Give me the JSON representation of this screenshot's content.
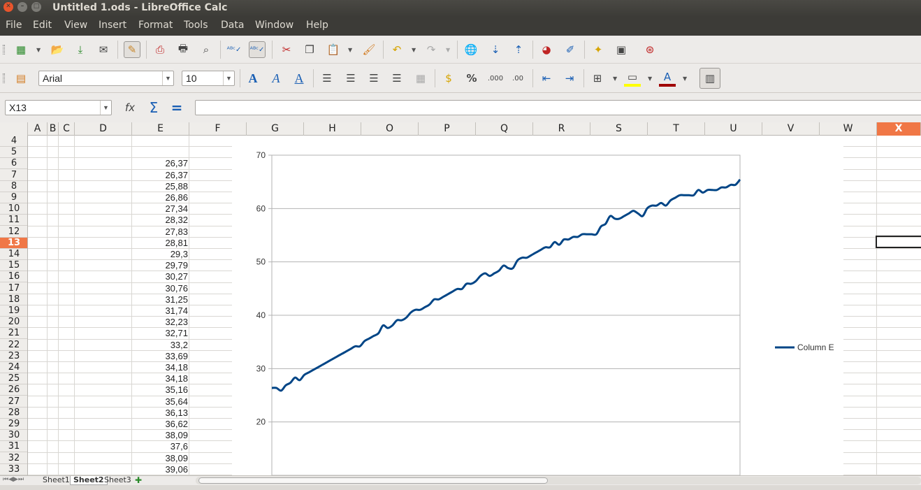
{
  "window": {
    "title": "Untitled 1.ods - LibreOffice Calc"
  },
  "menu": [
    "File",
    "Edit",
    "View",
    "Insert",
    "Format",
    "Tools",
    "Data",
    "Window",
    "Help"
  ],
  "formatting": {
    "font_name": "Arial",
    "font_size": "10"
  },
  "name_box": "X13",
  "formula": "",
  "columns": [
    "A",
    "B",
    "C",
    "D",
    "E",
    "F",
    "G",
    "H",
    "O",
    "P",
    "Q",
    "R",
    "S",
    "T",
    "U",
    "V",
    "W",
    "X"
  ],
  "selected_column": "X",
  "rows": [
    4,
    5,
    6,
    7,
    8,
    9,
    10,
    11,
    12,
    13,
    14,
    15,
    16,
    17,
    18,
    19,
    20,
    21,
    22,
    23,
    24,
    25,
    26,
    27,
    28,
    29,
    30,
    31,
    32,
    33
  ],
  "selected_row": 13,
  "column_e_values": [
    "",
    "",
    "26,37",
    "26,37",
    "25,88",
    "26,86",
    "27,34",
    "28,32",
    "27,83",
    "28,81",
    "29,3",
    "29,79",
    "30,27",
    "30,76",
    "31,25",
    "31,74",
    "32,23",
    "32,71",
    "33,2",
    "33,69",
    "34,18",
    "34,18",
    "35,16",
    "35,64",
    "36,13",
    "36,62",
    "38,09",
    "37,6",
    "38,09",
    "39,06"
  ],
  "sheets": [
    "Sheet1",
    "Sheet2",
    "Sheet3"
  ],
  "active_sheet": "Sheet2",
  "chart_data": {
    "type": "line",
    "series": [
      {
        "name": "Column E",
        "values": [
          26.37,
          26.37,
          25.88,
          26.86,
          27.34,
          28.32,
          27.83,
          28.81,
          29.3,
          29.79,
          30.27,
          30.76,
          31.25,
          31.74,
          32.23,
          32.71,
          33.2,
          33.69,
          34.18,
          34.18,
          35.16,
          35.64,
          36.13,
          36.62,
          38.09,
          37.6,
          38.09,
          39.06,
          39.06,
          39.55,
          40.53,
          41.02,
          41.02,
          41.5,
          42.0,
          42.97,
          42.97,
          43.46,
          43.95,
          44.44,
          44.93,
          44.93,
          45.9,
          45.9,
          46.39,
          47.37,
          47.86,
          47.37,
          47.86,
          48.34,
          49.32,
          48.83,
          48.83,
          50.29,
          50.78,
          50.78,
          51.27,
          51.76,
          52.25,
          52.74,
          52.74,
          53.71,
          53.22,
          54.2,
          54.2,
          54.69,
          54.69,
          55.18,
          55.18,
          55.18,
          55.18,
          56.64,
          57.13,
          58.59,
          58.1,
          58.1,
          58.59,
          59.08,
          59.57,
          59.08,
          58.59,
          60.06,
          60.55,
          60.55,
          61.04,
          60.55,
          61.52,
          62.01,
          62.5,
          62.5,
          62.5,
          62.5,
          63.48,
          62.99,
          63.48,
          63.48,
          63.48,
          63.96,
          63.96,
          64.45,
          64.45,
          65.43
        ]
      }
    ],
    "ylim": [
      10,
      70
    ],
    "yticks": [
      20,
      30,
      40,
      50,
      60,
      70
    ],
    "grid": true,
    "legend": "right"
  },
  "colors": {
    "selection": "#f07746",
    "series": "#004586",
    "titlebar": "#3c3b37"
  }
}
